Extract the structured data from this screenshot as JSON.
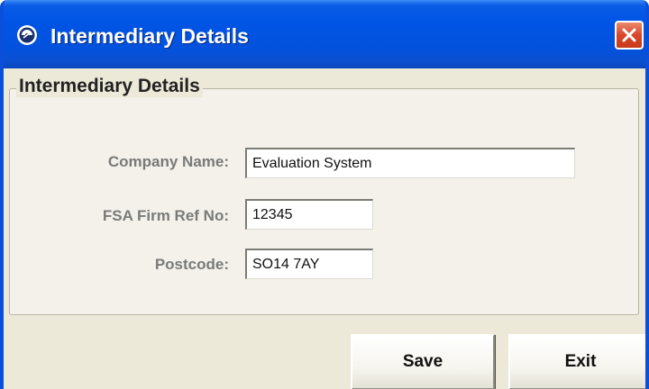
{
  "window": {
    "title": "Intermediary Details"
  },
  "group": {
    "legend": "Intermediary Details"
  },
  "form": {
    "company_name_label": "Company Name:",
    "company_name_value": "Evaluation System",
    "fsa_label": "FSA Firm Ref No:",
    "fsa_value": "12345",
    "postcode_label": "Postcode:",
    "postcode_value": "SO14 7AY"
  },
  "buttons": {
    "save_label": "Save",
    "exit_label": "Exit"
  },
  "colors": {
    "titlebar": "#0055e5",
    "window_bg": "#ece9d8",
    "close_button": "#d8472a"
  },
  "icons": {
    "title": "app-logo-icon",
    "close": "close-icon"
  }
}
